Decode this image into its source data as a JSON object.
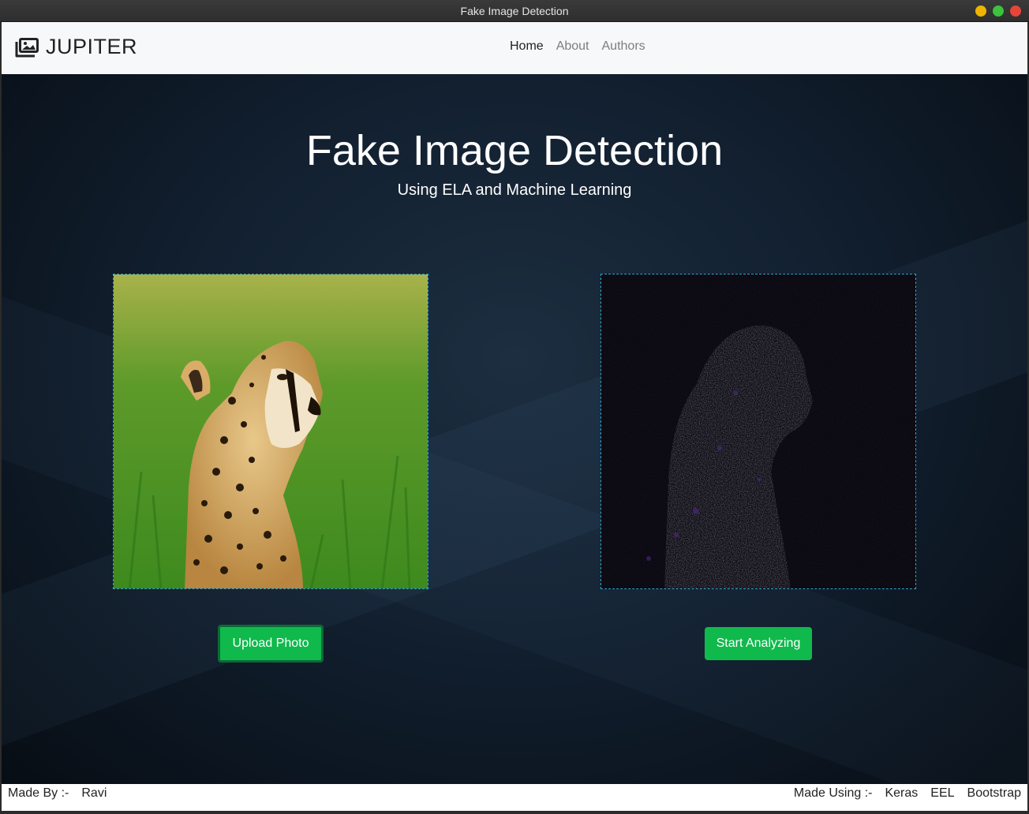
{
  "window": {
    "title": "Fake Image Detection",
    "controls": [
      {
        "name": "minimize",
        "color": "#f0b400"
      },
      {
        "name": "maximize",
        "color": "#3cc23c"
      },
      {
        "name": "close",
        "color": "#e8443a"
      }
    ]
  },
  "navbar": {
    "brand_icon": "images-icon",
    "brand": "JUPITER",
    "links": [
      "Home",
      "About",
      "Authors"
    ],
    "active_link": "Home"
  },
  "hero": {
    "title": "Fake Image Detection",
    "subtitle": "Using ELA and Machine Learning"
  },
  "images": {
    "uploaded": "cheetah-photo",
    "ela_result": "ela-noise-map"
  },
  "buttons": {
    "upload": "Upload Photo",
    "analyze": "Start Analyzing"
  },
  "footer": {
    "made_by_label": "Made By :-",
    "author": "Ravi",
    "made_using_label": "Made Using :-",
    "technologies": [
      "Keras",
      "EEL",
      "Bootstrap"
    ]
  },
  "colors": {
    "accent_button": "#10b94c",
    "image_border": "#2ea3c9",
    "hero_background": "#122030"
  }
}
